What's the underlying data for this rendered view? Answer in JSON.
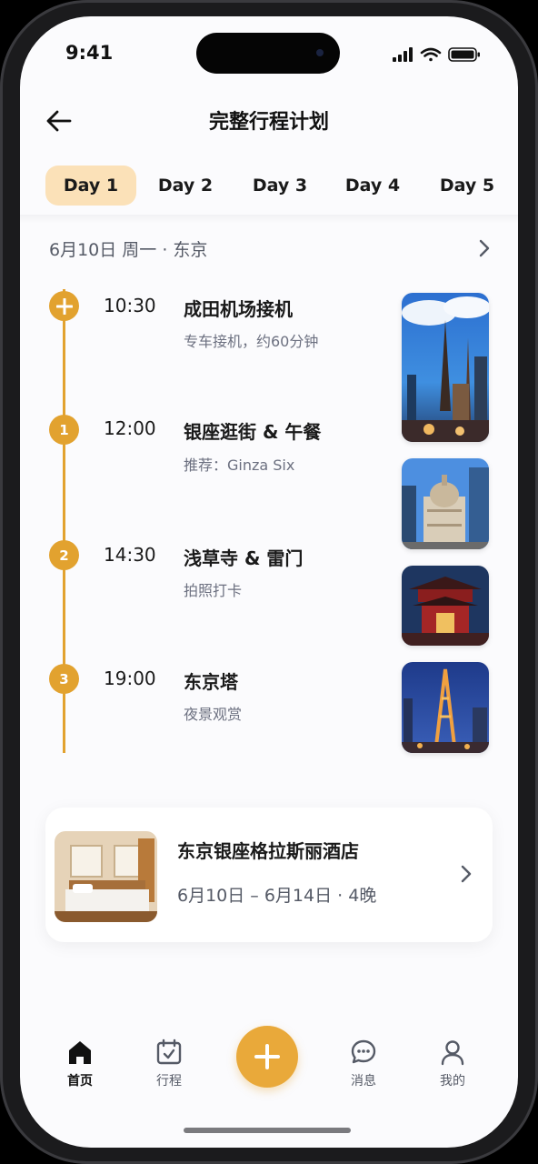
{
  "status_bar": {
    "time": "9:41"
  },
  "header": {
    "title": "完整行程计划"
  },
  "day_tabs": [
    {
      "label": "Day 1",
      "active": true
    },
    {
      "label": "Day 2",
      "active": false
    },
    {
      "label": "Day 3",
      "active": false
    },
    {
      "label": "Day 4",
      "active": false
    },
    {
      "label": "Day 5",
      "active": false
    }
  ],
  "date_row": {
    "text": "6月10日 周一 · 东京"
  },
  "timeline": [
    {
      "marker": "+",
      "time": "10:30",
      "title": "成田机场接机",
      "subtitle": "专车接机，约60分钟",
      "image": "tokyo-skyline-photo"
    },
    {
      "marker": "1",
      "time": "12:00",
      "title": "银座逛街 & 午餐",
      "subtitle": "推荐：Ginza Six",
      "image": "ginza-building-photo"
    },
    {
      "marker": "2",
      "time": "14:30",
      "title": "浅草寺 & 雷门",
      "subtitle": "拍照打卡",
      "image": "sensoji-temple-photo"
    },
    {
      "marker": "3",
      "time": "19:00",
      "title": "东京塔",
      "subtitle": "夜景观赏",
      "image": "tokyo-tower-photo"
    }
  ],
  "hotel": {
    "name": "东京银座格拉斯丽酒店",
    "dates": "6月10日 – 6月14日 · 4晚",
    "image": "hotel-room-photo"
  },
  "bottom_nav": {
    "items": [
      {
        "label": "首页",
        "icon": "home-icon",
        "active": true
      },
      {
        "label": "行程",
        "icon": "calendar-icon",
        "active": false
      },
      {
        "label": "消息",
        "icon": "chat-icon",
        "active": false
      },
      {
        "label": "我的",
        "icon": "user-icon",
        "active": false
      }
    ],
    "fab_icon": "plus-icon"
  },
  "colors": {
    "accent": "#e2a22f",
    "tab_active_bg": "#fbe1b8",
    "text_primary": "#1a1a1a",
    "text_secondary": "#6c7080"
  }
}
